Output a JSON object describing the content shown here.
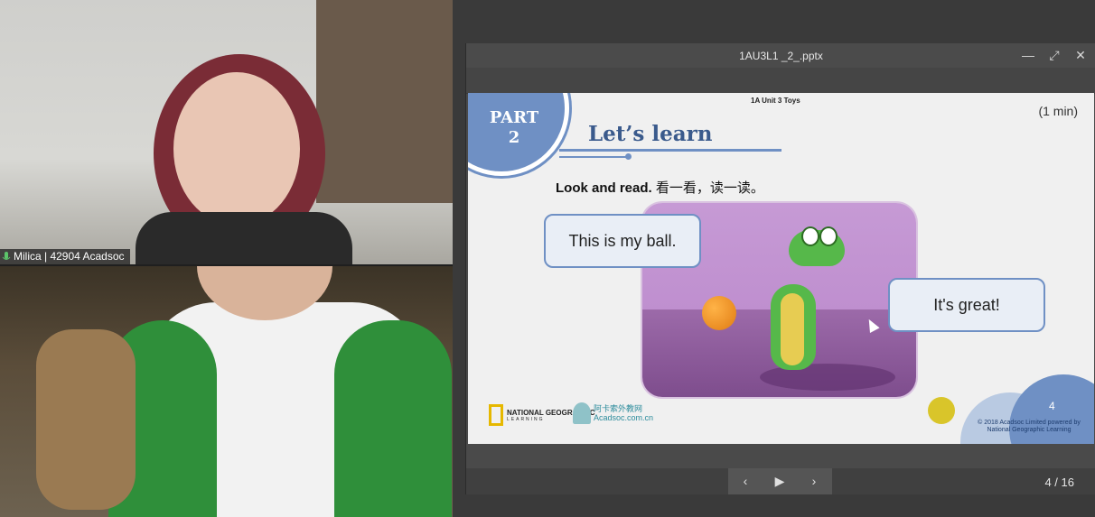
{
  "participants": {
    "teacher": {
      "name_tag": "Milica | 42904 Acadsoc"
    }
  },
  "viewer": {
    "file_name": "1AU3L1 _2_.pptx",
    "window_buttons": {
      "minimize": "—",
      "restore": "⤢",
      "close": "✕"
    },
    "page_counter": "4 / 16",
    "nav": {
      "prev": "‹",
      "play": "▶",
      "next": "›"
    }
  },
  "slide": {
    "unit_label": "1A Unit 3 Toys",
    "time": "(1 min)",
    "part_label": "PART",
    "part_number": "2",
    "heading": "Let’s learn",
    "instruction_en": "Look and read.",
    "instruction_cn": " 看一看，读一读。",
    "bubble_left": "This is my ball.",
    "bubble_right": "It's great!",
    "page_number": "4",
    "copyright": "© 2018 Acadsoc Limited powered by National Geographic Learning",
    "logo_ng": "NATIONAL GEOGRAPHIC",
    "logo_ng_sub": "LEARNING",
    "logo_acad": "阿卡索外教网",
    "logo_acad_url": "Acadsoc.com.cn"
  },
  "colors": {
    "slide_accent": "#6f90c4",
    "heading": "#3a5a8c",
    "yellow_dot": "#d9c52a"
  }
}
